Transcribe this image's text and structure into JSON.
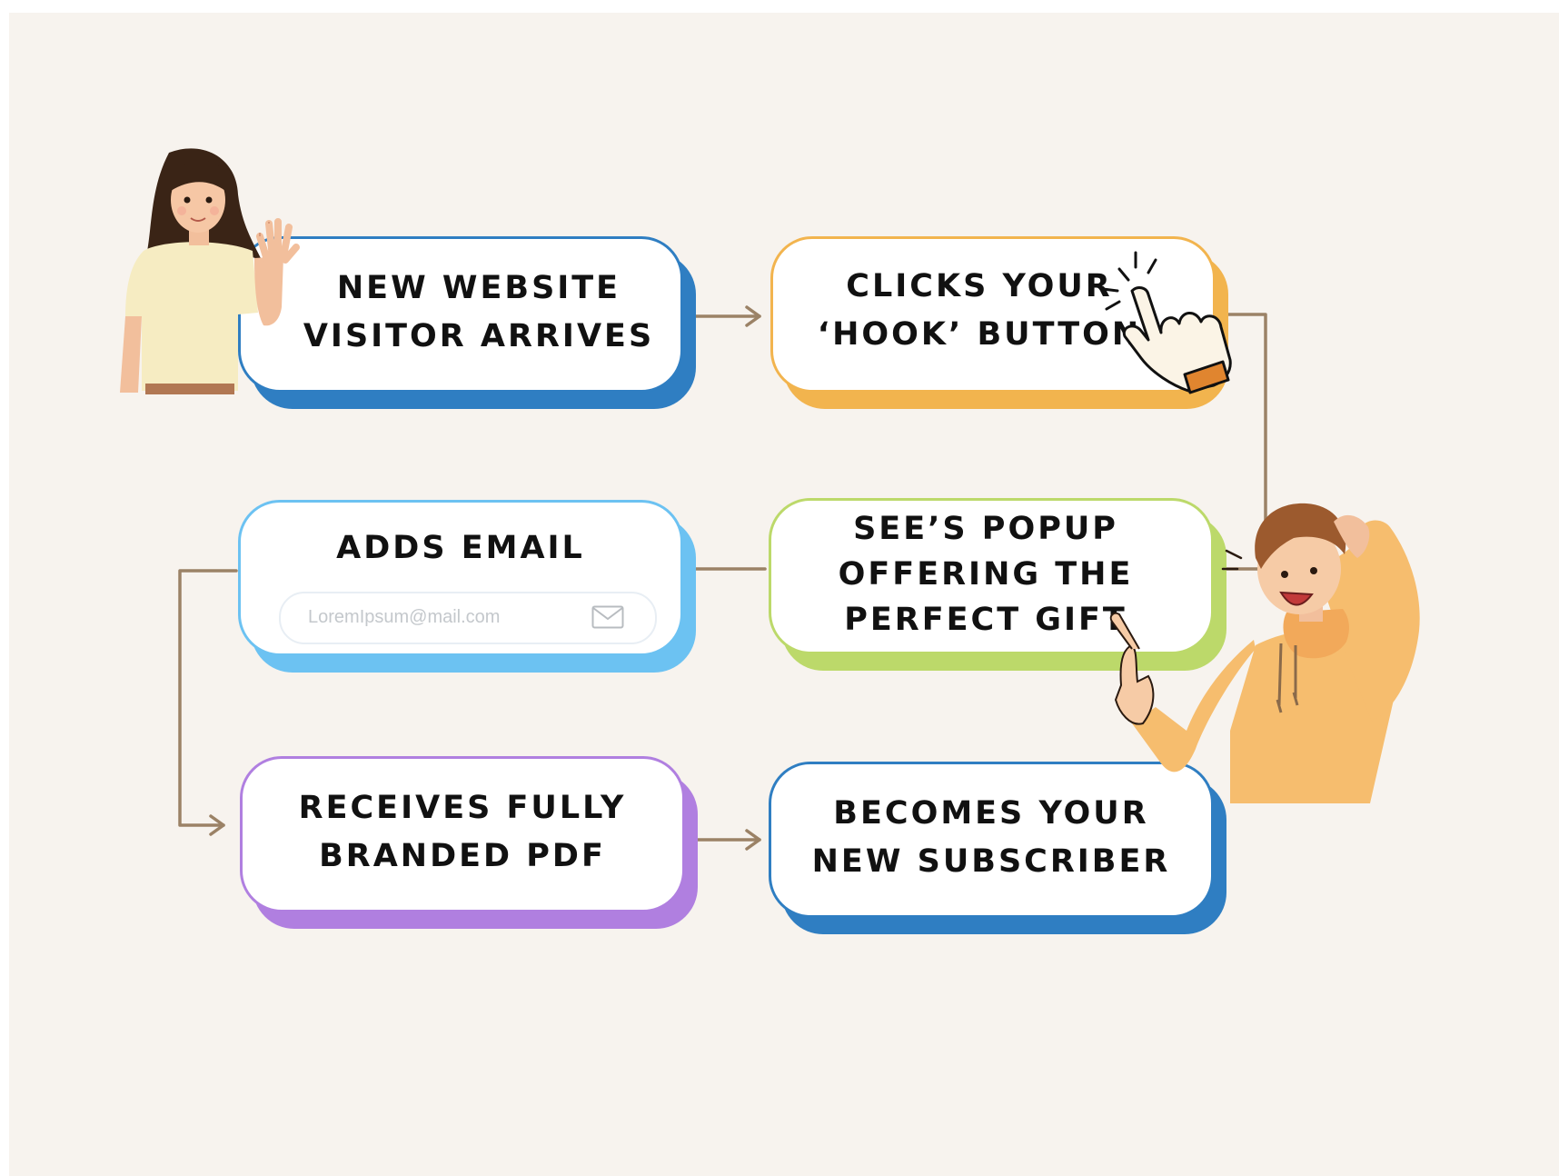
{
  "diagram": {
    "steps": [
      {
        "id": "arrive",
        "label": "NEW WEBSITE\nVISITOR ARRIVES",
        "color": "#2f7ec2"
      },
      {
        "id": "click",
        "label": "CLICKS YOUR\n‘HOOK’ BUTTON",
        "color": "#f2b44e"
      },
      {
        "id": "popup",
        "label": "SEE’S POPUP\nOFFERING THE\nPERFECT GIFT",
        "color": "#bcd96a"
      },
      {
        "id": "email",
        "label": "ADDS EMAIL",
        "color": "#6cc2f2"
      },
      {
        "id": "pdf",
        "label": "RECEIVES FULLY\nBRANDED PDF",
        "color": "#b07fe0"
      },
      {
        "id": "subscriber",
        "label": "BECOMES YOUR\nNEW SUBSCRIBER",
        "color": "#2f7ec2"
      }
    ],
    "email_input": {
      "placeholder": "LoremIpsum@mail.com",
      "icon": "envelope-icon"
    },
    "connector_color": "#9b8266",
    "illustrations": [
      "waving-woman-illustration",
      "pointing-hand-cursor-icon",
      "pointing-man-illustration"
    ]
  }
}
